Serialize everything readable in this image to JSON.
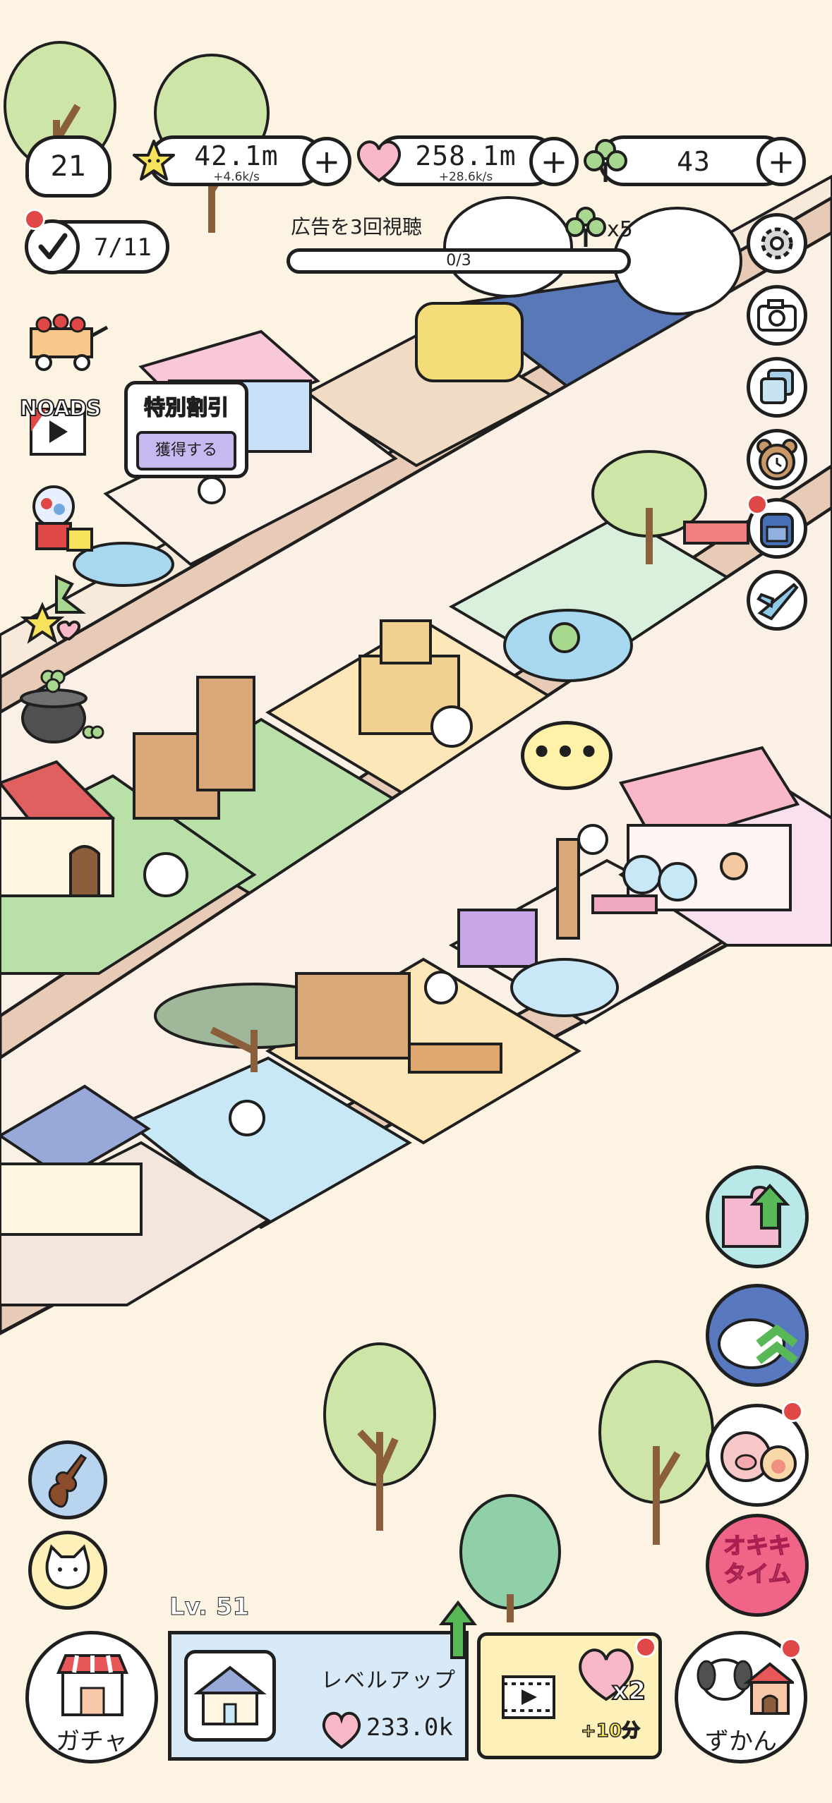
{
  "hud": {
    "level": "21",
    "stars": {
      "value": "42.1m",
      "rate": "+4.6k/s",
      "icon": "star-icon"
    },
    "hearts": {
      "value": "258.1m",
      "rate": "+28.6k/s",
      "icon": "heart-icon"
    },
    "clovers": {
      "value": "43",
      "icon": "clover-icon"
    },
    "plus": "+"
  },
  "tasks": {
    "progress": "7/11"
  },
  "ad_task": {
    "label": "広告を3回視聴",
    "progress": "0/3",
    "reward": "x5"
  },
  "left_menu": {
    "noads": "NOADS",
    "sale_title": "特別割引",
    "sale_button": "獲得する"
  },
  "speech": "•••",
  "right_buttons": {
    "okiki": "オキキ\nタイム"
  },
  "bottom": {
    "gacha": "ガチャ",
    "level": "Lv. 51",
    "levelup": "レベルアップ",
    "levelup_cost": "233.0k",
    "ad_multiplier": "x2",
    "ad_bonus": "+10分",
    "zukan": "ずかん"
  },
  "colors": {
    "background": "#fdf3e3",
    "outline": "#1f1f1f",
    "grass": "#b8e0a8",
    "road": "#e8c8b4",
    "water": "#c8e8f8",
    "pink": "#f8c8d8",
    "accent_red": "#e04848"
  }
}
